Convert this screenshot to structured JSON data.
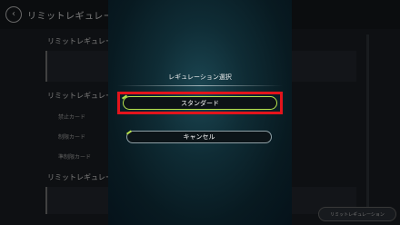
{
  "background": {
    "page_title": "リミットレギュレーション",
    "section_1": "リミットレギュレー",
    "section_2": "リミットレギュレー",
    "section_3": "リミットレギュレー",
    "row_1": "禁止カード",
    "row_2": "制限カード",
    "row_3": "準制限カード",
    "corner_button": "リミットレギュレーション"
  },
  "modal": {
    "title": "レギュレーション選択",
    "standard_label": "スタンダード",
    "cancel_label": "キャンセル"
  },
  "colors": {
    "accent": "#b8e44c",
    "highlight": "#e3141c",
    "modal_bg": "#0f2c35"
  }
}
